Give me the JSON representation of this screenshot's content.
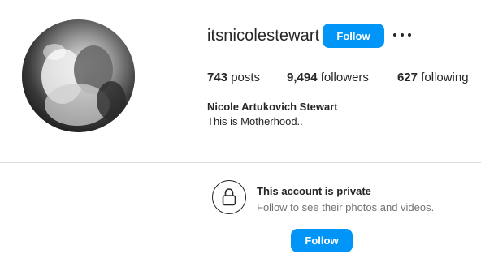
{
  "profile": {
    "username": "itsnicolestewart",
    "follow_label": "Follow",
    "more_icon": "more-horizontal-icon",
    "stats": {
      "posts_count": "743",
      "posts_label": "posts",
      "followers_count": "9,494",
      "followers_label": "followers",
      "following_count": "627",
      "following_label": "following"
    },
    "full_name": "Nicole Artukovich Stewart",
    "bio": "This is Motherhood.."
  },
  "private_notice": {
    "icon": "lock-icon",
    "title": "This account is private",
    "subtitle": "Follow to see their photos and videos.",
    "follow_label": "Follow"
  },
  "colors": {
    "accent": "#0095f6",
    "text": "#262626",
    "muted": "#737373",
    "divider": "#dbdbdb"
  }
}
